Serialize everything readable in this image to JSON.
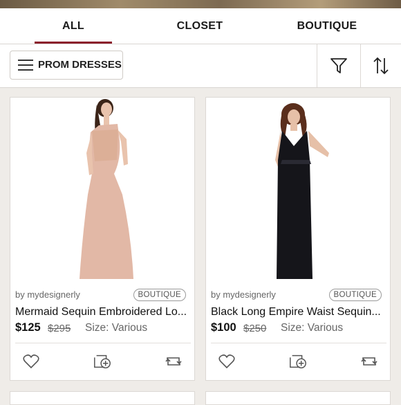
{
  "tabs": [
    {
      "label": "ALL"
    },
    {
      "label": "CLOSET"
    },
    {
      "label": "BOUTIQUE"
    }
  ],
  "filter": {
    "category_label": "PROM DRESSES",
    "icons": [
      "menu-icon",
      "filter-icon",
      "sort-icon"
    ]
  },
  "listings": [
    {
      "seller": "by mydesignerly",
      "badge": "BOUTIQUE",
      "title": "Mermaid Sequin Embroidered Lo...",
      "price": "$125",
      "original_price": "$295",
      "size": "Size: Various",
      "dress_color": "#e2b8a6"
    },
    {
      "seller": "by mydesignerly",
      "badge": "BOUTIQUE",
      "title": "Black Long Empire Waist Sequin...",
      "price": "$100",
      "original_price": "$250",
      "size": "Size: Various",
      "dress_color": "#15151a"
    }
  ],
  "actions": [
    "heart-icon",
    "add-to-bundle-icon",
    "share-icon"
  ]
}
